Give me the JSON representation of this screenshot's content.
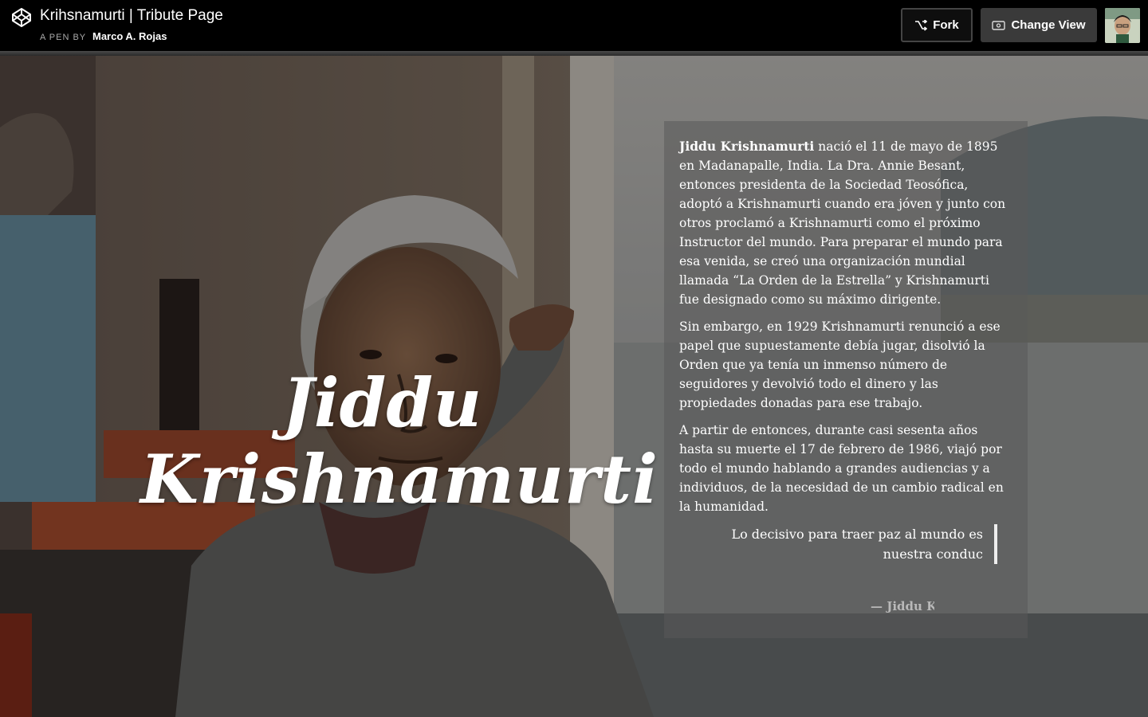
{
  "header": {
    "title": "Krihsnamurti | Tribute Page",
    "pen_by": "A PEN BY",
    "author": "Marco A. Rojas",
    "fork_label": "Fork",
    "change_view_label": "Change View"
  },
  "hero": {
    "name_line1": "Jiddu",
    "name_line2": "Krishnamurti"
  },
  "bio": {
    "p1_name": "Jiddu Krishnamurti",
    "p1_rest": " nació el 11 de mayo de 1895 en Madanapalle, India. La Dra. Annie Besant, entonces presidenta de la Sociedad Teosófica, adoptó a Krishnamurti cuando era jóven y junto con otros proclamó a Krishnamurti como el próximo Instructor del mundo. Para preparar el mundo para esa venida, se creó una organización mundial llamada “La Orden de la Estrella” y Krishnamurti fue designado como su máximo dirigente.",
    "p2": "Sin embargo, en 1929 Krishnamurti renunció a ese papel que supuestamente debía jugar, disolvió la Orden que ya tenía un inmenso número de seguidores y devolvió todo el dinero y las propiedades donadas para ese trabajo.",
    "p3": "A partir de entonces, durante casi sesenta años hasta su muerte el 17 de febrero de 1986, viajó por todo el mundo hablando a grandes audiencias y a individuos, de la necesidad de un cambio radical en la humanidad.",
    "quote": "Lo decisivo para traer paz al mundo es nuestra conduc",
    "quote_author": "— Jiddu K"
  },
  "icons": {
    "logo": "codepen-logo-icon",
    "fork": "fork-icon",
    "change_view": "change-view-icon"
  }
}
